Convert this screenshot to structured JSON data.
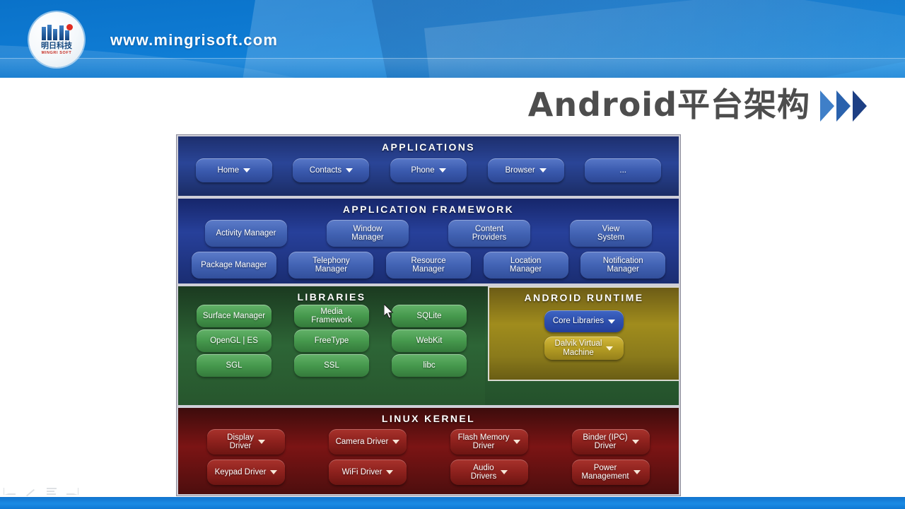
{
  "header": {
    "site_url": "www.mingrisoft.com",
    "logo": {
      "cn_name": "明日科技",
      "en_name": "MINGRI SOFT",
      "dot_color": "#e02b20",
      "text_color": "#14487f"
    },
    "background_color": "#0e7ad2"
  },
  "slide": {
    "title": "Android平台架构",
    "title_color": "#4d4d4d",
    "chevron_colors": [
      "#3f7fc8",
      "#2a62ad",
      "#1d3f84"
    ]
  },
  "diagram": {
    "name": "android-platform-architecture-stack",
    "layers": [
      {
        "id": "applications",
        "title": "Applications",
        "background_color": "#2a4597",
        "rows": [
          [
            {
              "label": "Home",
              "has_caret": true
            },
            {
              "label": "Contacts",
              "has_caret": true
            },
            {
              "label": "Phone",
              "has_caret": true
            },
            {
              "label": "Browser",
              "has_caret": true
            },
            {
              "label": "...",
              "has_caret": false
            }
          ]
        ]
      },
      {
        "id": "application-framework",
        "title": "Application Framework",
        "background_color": "#27409a",
        "rows": [
          [
            {
              "label": "Activity Manager",
              "has_caret": false
            },
            {
              "label": "Window Manager",
              "has_caret": false
            },
            {
              "label": "Content Providers",
              "has_caret": false
            },
            {
              "label": "View System",
              "has_caret": false
            }
          ],
          [
            {
              "label": "Package Manager",
              "has_caret": false
            },
            {
              "label": "Telephony Manager",
              "has_caret": false
            },
            {
              "label": "Resource Manager",
              "has_caret": false
            },
            {
              "label": "Location Manager",
              "has_caret": false
            },
            {
              "label": "Notification Manager",
              "has_caret": false
            }
          ]
        ]
      },
      {
        "id": "libraries",
        "title": "Libraries",
        "background_color": "#2d6536",
        "rows": [
          [
            {
              "label": "Surface Manager",
              "has_caret": false
            },
            {
              "label": "Media Framework",
              "has_caret": false
            },
            {
              "label": "SQLite",
              "has_caret": false
            }
          ],
          [
            {
              "label": "OpenGL | ES",
              "has_caret": false
            },
            {
              "label": "FreeType",
              "has_caret": false
            },
            {
              "label": "WebKit",
              "has_caret": false
            }
          ],
          [
            {
              "label": "SGL",
              "has_caret": false
            },
            {
              "label": "SSL",
              "has_caret": false
            },
            {
              "label": "libc",
              "has_caret": false
            }
          ]
        ]
      },
      {
        "id": "android-runtime",
        "title": "Android Runtime",
        "background_color": "#a08c1d",
        "rows": [
          [
            {
              "label": "Core Libraries",
              "has_caret": true
            },
            {
              "label": "Dalvik Virtual Machine",
              "has_caret": true
            }
          ]
        ]
      },
      {
        "id": "linux-kernel",
        "title": "Linux Kernel",
        "background_color": "#7b1414",
        "rows": [
          [
            {
              "label": "Display Driver",
              "has_caret": true
            },
            {
              "label": "Camera Driver",
              "has_caret": true
            },
            {
              "label": "Flash Memory Driver",
              "has_caret": true
            },
            {
              "label": "Binder (IPC) Driver",
              "has_caret": true
            }
          ],
          [
            {
              "label": "Keypad Driver",
              "has_caret": true
            },
            {
              "label": "WiFi Driver",
              "has_caret": true
            },
            {
              "label": "Audio Drivers",
              "has_caret": true
            },
            {
              "label": "Power Management",
              "has_caret": true
            }
          ]
        ]
      }
    ]
  },
  "apps": {
    "home": "Home",
    "contacts": "Contacts",
    "phone": "Phone",
    "browser": "Browser",
    "more": "..."
  },
  "framework": {
    "activity_manager": "Activity Manager",
    "window_manager_l1": "Window",
    "window_manager_l2": "Manager",
    "content_providers_l1": "Content",
    "content_providers_l2": "Providers",
    "view_system_l1": "View",
    "view_system_l2": "System",
    "package_manager": "Package Manager",
    "telephony_manager_l1": "Telephony",
    "telephony_manager_l2": "Manager",
    "resource_manager_l1": "Resource",
    "resource_manager_l2": "Manager",
    "location_manager_l1": "Location",
    "location_manager_l2": "Manager",
    "notification_manager_l1": "Notification",
    "notification_manager_l2": "Manager"
  },
  "libraries": {
    "surface_manager": "Surface Manager",
    "media_framework_l1": "Media",
    "media_framework_l2": "Framework",
    "sqlite": "SQLite",
    "opengl_es": "OpenGL | ES",
    "freetype": "FreeType",
    "webkit": "WebKit",
    "sgl": "SGL",
    "ssl": "SSL",
    "libc": "libc"
  },
  "runtime": {
    "core_libraries": "Core Libraries",
    "dalvik_l1": "Dalvik Virtual",
    "dalvik_l2": "Machine"
  },
  "kernel": {
    "display_driver_l1": "Display",
    "display_driver_l2": "Driver",
    "camera_driver": "Camera Driver",
    "flash_memory_l1": "Flash Memory",
    "flash_memory_l2": "Driver",
    "binder_ipc_l1": "Binder (IPC)",
    "binder_ipc_l2": "Driver",
    "keypad_driver": "Keypad Driver",
    "wifi_driver": "WiFi Driver",
    "audio_drivers_l1": "Audio",
    "audio_drivers_l2": "Drivers",
    "power_management_l1": "Power",
    "power_management_l2": "Management"
  },
  "titles": {
    "applications": "Applications",
    "application_framework": "Application Framework",
    "libraries": "Libraries",
    "android_runtime": "Android Runtime",
    "linux_kernel": "Linux Kernel"
  },
  "bottom": {
    "bar_color": "#1a8ae4"
  }
}
